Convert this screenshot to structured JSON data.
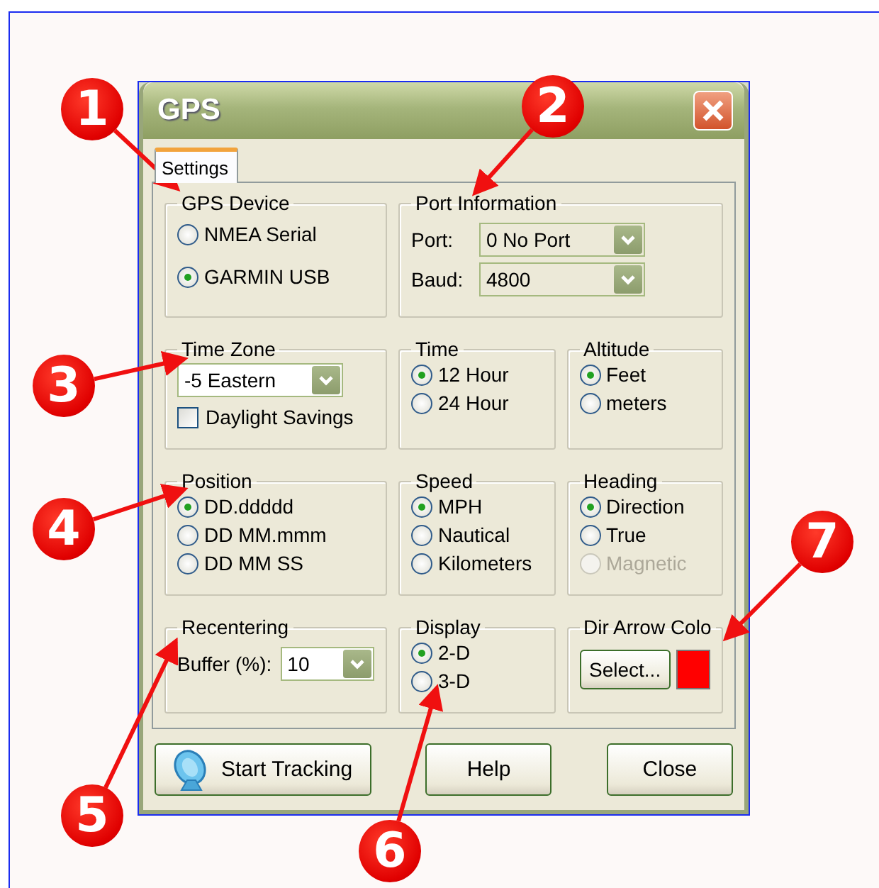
{
  "callouts": [
    {
      "label": "1"
    },
    {
      "label": "2"
    },
    {
      "label": "3"
    },
    {
      "label": "4"
    },
    {
      "label": "5"
    },
    {
      "label": "6"
    },
    {
      "label": "7"
    }
  ],
  "window": {
    "title": "GPS"
  },
  "tabs": [
    {
      "label": "Settings",
      "selected": true
    }
  ],
  "rows": [
    [
      {
        "kind": "radios",
        "title": "GPS Device",
        "options": [
          {
            "label": "NMEA Serial",
            "selected": false,
            "disabled": false
          },
          {
            "label": "GARMIN USB",
            "selected": true,
            "disabled": false
          }
        ]
      },
      {
        "kind": "fields",
        "title": "Port Information",
        "fields": [
          {
            "label": "Port:",
            "value": "0 No Port"
          },
          {
            "label": "Baud:",
            "value": "4800"
          }
        ]
      }
    ],
    [
      {
        "kind": "timezone",
        "title": "Time Zone",
        "value": "-5 Eastern",
        "checkbox": {
          "label": "Daylight Savings",
          "checked": false
        }
      },
      {
        "kind": "radios",
        "title": "Time",
        "options": [
          {
            "label": "12 Hour",
            "selected": true,
            "disabled": false
          },
          {
            "label": "24 Hour",
            "selected": false,
            "disabled": false
          }
        ]
      },
      {
        "kind": "radios",
        "title": "Altitude",
        "options": [
          {
            "label": "Feet",
            "selected": true,
            "disabled": false
          },
          {
            "label": "meters",
            "selected": false,
            "disabled": false
          }
        ]
      }
    ],
    [
      {
        "kind": "radios",
        "title": "Position",
        "options": [
          {
            "label": "DD.ddddd",
            "selected": true,
            "disabled": false
          },
          {
            "label": "DD MM.mmm",
            "selected": false,
            "disabled": false
          },
          {
            "label": "DD MM SS",
            "selected": false,
            "disabled": false
          }
        ]
      },
      {
        "kind": "radios",
        "title": "Speed",
        "options": [
          {
            "label": "MPH",
            "selected": true,
            "disabled": false
          },
          {
            "label": "Nautical",
            "selected": false,
            "disabled": false
          },
          {
            "label": "Kilometers",
            "selected": false,
            "disabled": false
          }
        ]
      },
      {
        "kind": "radios",
        "title": "Heading",
        "options": [
          {
            "label": "Direction",
            "selected": true,
            "disabled": false
          },
          {
            "label": "True",
            "selected": false,
            "disabled": false
          },
          {
            "label": "Magnetic",
            "selected": false,
            "disabled": true
          }
        ]
      }
    ],
    [
      {
        "kind": "fields",
        "title": "Recentering",
        "fields": [
          {
            "label": "Buffer (%):",
            "value": "10"
          }
        ]
      },
      {
        "kind": "radios",
        "title": "Display",
        "options": [
          {
            "label": "2-D",
            "selected": true,
            "disabled": false
          },
          {
            "label": "3-D",
            "selected": false,
            "disabled": false
          }
        ]
      },
      {
        "kind": "color",
        "title": "Dir Arrow Colo",
        "button": "Select...",
        "color": "#ff0000"
      }
    ]
  ],
  "buttons": [
    {
      "label": "Start Tracking",
      "kind": "icon"
    },
    {
      "label": "Help",
      "kind": "plain"
    },
    {
      "label": "Close",
      "kind": "plain"
    }
  ]
}
